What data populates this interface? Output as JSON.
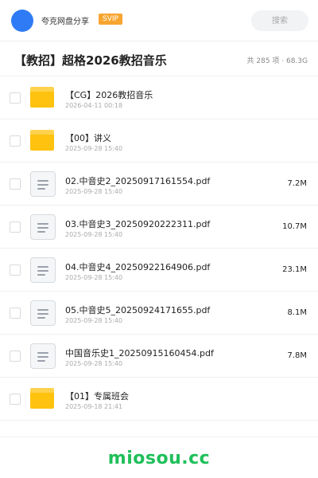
{
  "header": {
    "site_name": "夸克网盘分享",
    "badge": "SVIP",
    "search_placeholder": "搜索"
  },
  "title_row": {
    "title": "【教招】超格2026教招音乐",
    "summary": "共 285 项 · 68.3G"
  },
  "files": [
    {
      "type": "folder",
      "name": "【CG】2026教招音乐",
      "date": "2026-04-11 00:18",
      "size": ""
    },
    {
      "type": "folder",
      "name": "【00】讲义",
      "date": "2025-09-28 15:40",
      "size": ""
    },
    {
      "type": "doc",
      "name": "02.中音史2_20250917161554.pdf",
      "date": "2025-09-28 15:40",
      "size": "7.2M"
    },
    {
      "type": "doc",
      "name": "03.中音史3_20250920222311.pdf",
      "date": "2025-09-28 15:40",
      "size": "10.7M"
    },
    {
      "type": "doc",
      "name": "04.中音史4_20250922164906.pdf",
      "date": "2025-09-28 15:40",
      "size": "23.1M"
    },
    {
      "type": "doc",
      "name": "05.中音史5_20250924171655.pdf",
      "date": "2025-09-28 15:40",
      "size": "8.1M"
    },
    {
      "type": "doc",
      "name": "中国音乐史1_20250915160454.pdf",
      "date": "2025-09-28 15:40",
      "size": "7.8M"
    },
    {
      "type": "folder",
      "name": "【01】专属班会",
      "date": "2025-09-18 21:41",
      "size": ""
    }
  ],
  "footer": {
    "brand": "miosou.cc"
  },
  "colors": {
    "avatar": "#2f7bf6",
    "svip": "#f7a531",
    "folder": "#ffc20e",
    "brand": "#1fbf5a"
  }
}
